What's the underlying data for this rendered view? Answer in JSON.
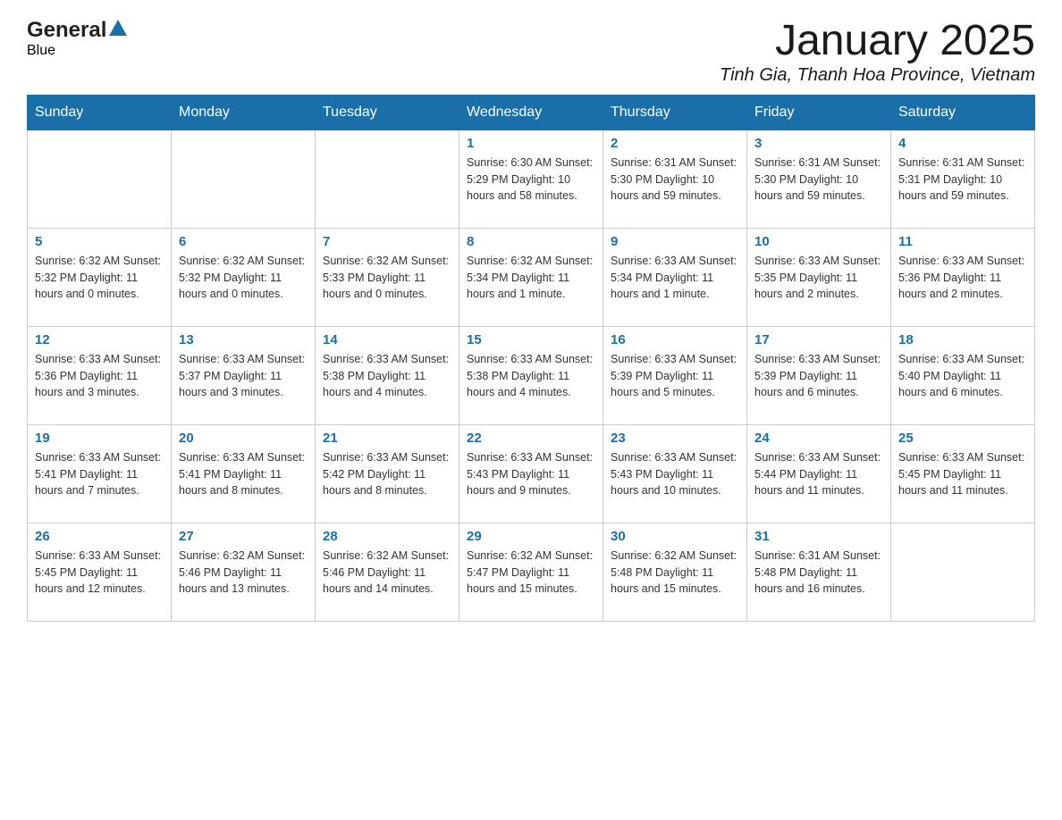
{
  "header": {
    "logo_general": "General",
    "logo_blue": "Blue",
    "title": "January 2025",
    "subtitle": "Tinh Gia, Thanh Hoa Province, Vietnam"
  },
  "calendar": {
    "days_of_week": [
      "Sunday",
      "Monday",
      "Tuesday",
      "Wednesday",
      "Thursday",
      "Friday",
      "Saturday"
    ],
    "weeks": [
      [
        {
          "day": "",
          "info": ""
        },
        {
          "day": "",
          "info": ""
        },
        {
          "day": "",
          "info": ""
        },
        {
          "day": "1",
          "info": "Sunrise: 6:30 AM\nSunset: 5:29 PM\nDaylight: 10 hours\nand 58 minutes."
        },
        {
          "day": "2",
          "info": "Sunrise: 6:31 AM\nSunset: 5:30 PM\nDaylight: 10 hours\nand 59 minutes."
        },
        {
          "day": "3",
          "info": "Sunrise: 6:31 AM\nSunset: 5:30 PM\nDaylight: 10 hours\nand 59 minutes."
        },
        {
          "day": "4",
          "info": "Sunrise: 6:31 AM\nSunset: 5:31 PM\nDaylight: 10 hours\nand 59 minutes."
        }
      ],
      [
        {
          "day": "5",
          "info": "Sunrise: 6:32 AM\nSunset: 5:32 PM\nDaylight: 11 hours\nand 0 minutes."
        },
        {
          "day": "6",
          "info": "Sunrise: 6:32 AM\nSunset: 5:32 PM\nDaylight: 11 hours\nand 0 minutes."
        },
        {
          "day": "7",
          "info": "Sunrise: 6:32 AM\nSunset: 5:33 PM\nDaylight: 11 hours\nand 0 minutes."
        },
        {
          "day": "8",
          "info": "Sunrise: 6:32 AM\nSunset: 5:34 PM\nDaylight: 11 hours\nand 1 minute."
        },
        {
          "day": "9",
          "info": "Sunrise: 6:33 AM\nSunset: 5:34 PM\nDaylight: 11 hours\nand 1 minute."
        },
        {
          "day": "10",
          "info": "Sunrise: 6:33 AM\nSunset: 5:35 PM\nDaylight: 11 hours\nand 2 minutes."
        },
        {
          "day": "11",
          "info": "Sunrise: 6:33 AM\nSunset: 5:36 PM\nDaylight: 11 hours\nand 2 minutes."
        }
      ],
      [
        {
          "day": "12",
          "info": "Sunrise: 6:33 AM\nSunset: 5:36 PM\nDaylight: 11 hours\nand 3 minutes."
        },
        {
          "day": "13",
          "info": "Sunrise: 6:33 AM\nSunset: 5:37 PM\nDaylight: 11 hours\nand 3 minutes."
        },
        {
          "day": "14",
          "info": "Sunrise: 6:33 AM\nSunset: 5:38 PM\nDaylight: 11 hours\nand 4 minutes."
        },
        {
          "day": "15",
          "info": "Sunrise: 6:33 AM\nSunset: 5:38 PM\nDaylight: 11 hours\nand 4 minutes."
        },
        {
          "day": "16",
          "info": "Sunrise: 6:33 AM\nSunset: 5:39 PM\nDaylight: 11 hours\nand 5 minutes."
        },
        {
          "day": "17",
          "info": "Sunrise: 6:33 AM\nSunset: 5:39 PM\nDaylight: 11 hours\nand 6 minutes."
        },
        {
          "day": "18",
          "info": "Sunrise: 6:33 AM\nSunset: 5:40 PM\nDaylight: 11 hours\nand 6 minutes."
        }
      ],
      [
        {
          "day": "19",
          "info": "Sunrise: 6:33 AM\nSunset: 5:41 PM\nDaylight: 11 hours\nand 7 minutes."
        },
        {
          "day": "20",
          "info": "Sunrise: 6:33 AM\nSunset: 5:41 PM\nDaylight: 11 hours\nand 8 minutes."
        },
        {
          "day": "21",
          "info": "Sunrise: 6:33 AM\nSunset: 5:42 PM\nDaylight: 11 hours\nand 8 minutes."
        },
        {
          "day": "22",
          "info": "Sunrise: 6:33 AM\nSunset: 5:43 PM\nDaylight: 11 hours\nand 9 minutes."
        },
        {
          "day": "23",
          "info": "Sunrise: 6:33 AM\nSunset: 5:43 PM\nDaylight: 11 hours\nand 10 minutes."
        },
        {
          "day": "24",
          "info": "Sunrise: 6:33 AM\nSunset: 5:44 PM\nDaylight: 11 hours\nand 11 minutes."
        },
        {
          "day": "25",
          "info": "Sunrise: 6:33 AM\nSunset: 5:45 PM\nDaylight: 11 hours\nand 11 minutes."
        }
      ],
      [
        {
          "day": "26",
          "info": "Sunrise: 6:33 AM\nSunset: 5:45 PM\nDaylight: 11 hours\nand 12 minutes."
        },
        {
          "day": "27",
          "info": "Sunrise: 6:32 AM\nSunset: 5:46 PM\nDaylight: 11 hours\nand 13 minutes."
        },
        {
          "day": "28",
          "info": "Sunrise: 6:32 AM\nSunset: 5:46 PM\nDaylight: 11 hours\nand 14 minutes."
        },
        {
          "day": "29",
          "info": "Sunrise: 6:32 AM\nSunset: 5:47 PM\nDaylight: 11 hours\nand 15 minutes."
        },
        {
          "day": "30",
          "info": "Sunrise: 6:32 AM\nSunset: 5:48 PM\nDaylight: 11 hours\nand 15 minutes."
        },
        {
          "day": "31",
          "info": "Sunrise: 6:31 AM\nSunset: 5:48 PM\nDaylight: 11 hours\nand 16 minutes."
        },
        {
          "day": "",
          "info": ""
        }
      ]
    ]
  }
}
